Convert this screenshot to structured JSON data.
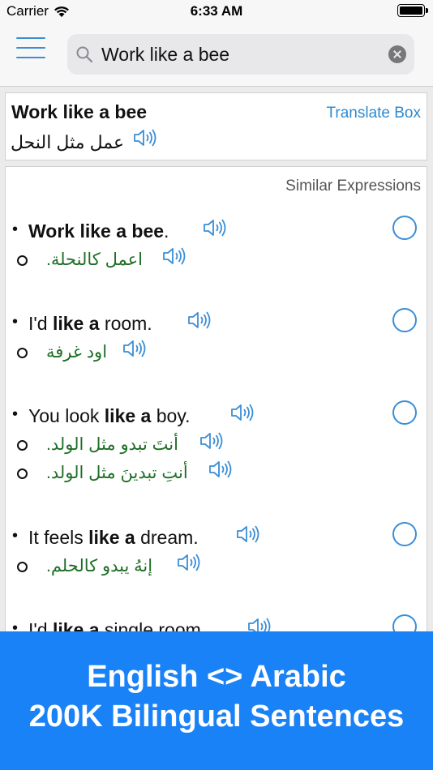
{
  "status_bar": {
    "carrier": "Carrier",
    "time": "6:33 AM"
  },
  "search": {
    "value": "Work like a bee"
  },
  "header": {
    "english": "Work like a bee",
    "translate_box_label": "Translate Box",
    "arabic": "عمل مثل النحل"
  },
  "results": {
    "title": "Similar Expressions",
    "entries": [
      {
        "en_parts": [
          {
            "t": "Work like a bee",
            "b": true
          },
          {
            "t": ".",
            "b": false
          }
        ],
        "ar": [
          "اعمل كالنحلة."
        ]
      },
      {
        "en_parts": [
          {
            "t": "I'd ",
            "b": false
          },
          {
            "t": "like a",
            "b": true
          },
          {
            "t": " room.",
            "b": false
          }
        ],
        "ar": [
          "اود غرفة"
        ]
      },
      {
        "en_parts": [
          {
            "t": "You look ",
            "b": false
          },
          {
            "t": "like a",
            "b": true
          },
          {
            "t": " boy.",
            "b": false
          }
        ],
        "ar": [
          "أنتَ تبدو مثل الولد.",
          "أنتِ تبدينَ مثل الولد."
        ]
      },
      {
        "en_parts": [
          {
            "t": "It feels ",
            "b": false
          },
          {
            "t": "like a",
            "b": true
          },
          {
            "t": " dream.",
            "b": false
          }
        ],
        "ar": [
          "إنهُ يبدو كالحلم."
        ]
      },
      {
        "en_parts": [
          {
            "t": "I'd ",
            "b": false
          },
          {
            "t": "like a",
            "b": true
          },
          {
            "t": " single room.",
            "b": false
          }
        ],
        "ar": []
      }
    ]
  },
  "promo": {
    "line1": "English <> Arabic",
    "line2": "200K Bilingual Sentences"
  },
  "colors": {
    "accent": "#3a8ed6",
    "link": "#2f8ad0",
    "arabic_text": "#1e6e26",
    "banner": "#1a82f7"
  },
  "icons": [
    "wifi-icon",
    "battery-icon",
    "menu-icon",
    "search-icon",
    "clear-icon",
    "speaker-icon",
    "select-circle-icon"
  ]
}
